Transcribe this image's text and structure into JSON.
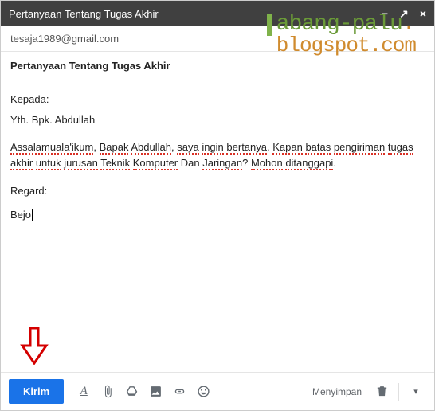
{
  "titlebar": {
    "title": "Pertanyaan Tentang Tugas Akhir"
  },
  "from": "tesaja1989@gmail.com",
  "subject": "Pertanyaan Tentang Tugas Akhir",
  "body": {
    "greeting_label": "Kepada:",
    "greeting_name": "Yth. Bpk. Abdullah",
    "para_words": {
      "w1": "Assalamuala'ikum",
      "c1": ", ",
      "w2": "Bapak",
      "sp": " ",
      "w3": "Abdullah",
      "c2": ", ",
      "w4": "saya",
      "w5": "ingin",
      "w6": "bertanya",
      "c3": ". ",
      "w7": "Kapan",
      "w8": "batas",
      "w9": "pengiriman",
      "w10": "tugas",
      "w11": "akhir",
      "w12": "untuk",
      "w13": "jurusan",
      "w14": "Teknik",
      "w15": "Komputer",
      "plain1": " Dan ",
      "w16": "Jaringan",
      "plain2": "? ",
      "w17": "Mohon",
      "w18": "ditanggapi",
      "c4": "."
    },
    "regard": "Regard:",
    "signature": "Bejo"
  },
  "toolbar": {
    "send_label": "Kirim",
    "saving_label": "Menyimpan"
  },
  "watermark": {
    "line1a": "abang-palu",
    "dot": ".",
    "line2": "blogspot.com"
  }
}
